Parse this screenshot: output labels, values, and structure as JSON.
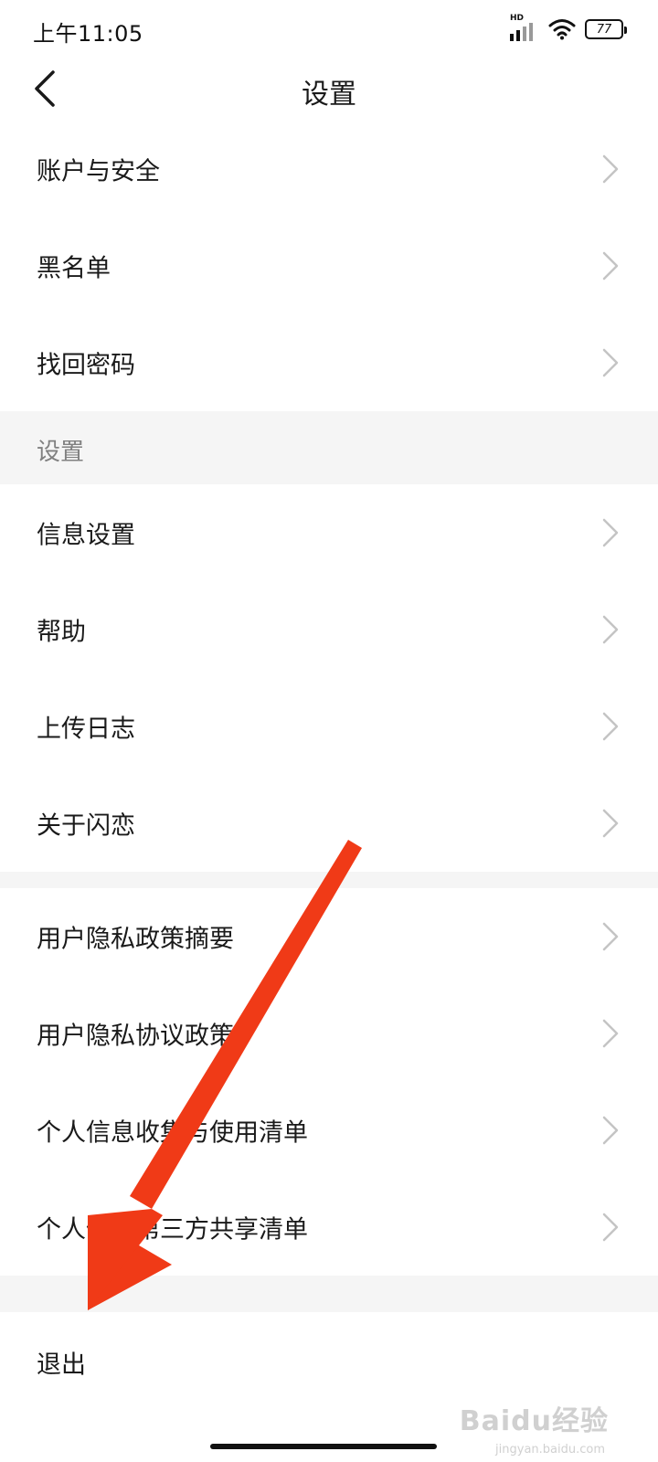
{
  "status_bar": {
    "time": "上午11:05",
    "hd": "HD",
    "battery": "77"
  },
  "nav": {
    "title": "设置"
  },
  "group1": {
    "items": [
      {
        "label": "账户与安全"
      },
      {
        "label": "黑名单"
      },
      {
        "label": "找回密码"
      }
    ]
  },
  "section_header": {
    "label": "设置"
  },
  "group2": {
    "items": [
      {
        "label": "信息设置"
      },
      {
        "label": "帮助"
      },
      {
        "label": "上传日志"
      },
      {
        "label": "关于闪恋"
      }
    ]
  },
  "group3": {
    "items": [
      {
        "label": "用户隐私政策摘要"
      },
      {
        "label": "用户隐私协议政策"
      },
      {
        "label": "个人信息收集与使用清单"
      },
      {
        "label": "个人信息第三方共享清单"
      }
    ]
  },
  "logout": {
    "label": "退出"
  },
  "watermark": {
    "text": "Baidu经验",
    "sub": "jingyan.baidu.com"
  },
  "colors": {
    "accent_arrow": "#f03a17",
    "section_bg": "#f5f5f5",
    "chevron": "#c4c4c4"
  }
}
